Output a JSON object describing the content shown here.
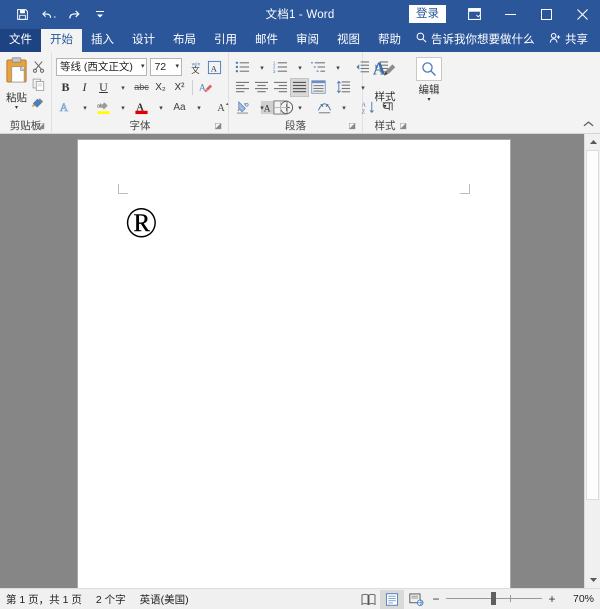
{
  "titlebar": {
    "document_title": "文档1  -  Word",
    "quick_access": [
      {
        "name": "save",
        "label": "保存"
      },
      {
        "name": "undo",
        "label": "撤消"
      },
      {
        "name": "redo",
        "label": "恢复"
      },
      {
        "name": "customize-qat",
        "label": "自定义快速访问工具栏"
      }
    ],
    "signin_label": "登录",
    "ribbon_display_label": "功能区显示选项",
    "minimize_label": "最小化",
    "maximize_label": "最大化",
    "close_label": "关闭"
  },
  "tabs": [
    {
      "label": "文件",
      "active": false,
      "file": true
    },
    {
      "label": "开始",
      "active": true
    },
    {
      "label": "插入",
      "active": false
    },
    {
      "label": "设计",
      "active": false
    },
    {
      "label": "布局",
      "active": false
    },
    {
      "label": "引用",
      "active": false
    },
    {
      "label": "邮件",
      "active": false
    },
    {
      "label": "审阅",
      "active": false
    },
    {
      "label": "视图",
      "active": false
    },
    {
      "label": "帮助",
      "active": false
    }
  ],
  "tellme": {
    "placeholder": "告诉我你想要做什么"
  },
  "share": {
    "label": "共享"
  },
  "ribbon": {
    "collapse_label": "折叠功能区",
    "groups": {
      "clipboard": {
        "label": "剪贴板",
        "paste_label": "粘贴",
        "cut_label": "剪切",
        "copy_label": "复制",
        "format_painter_label": "格式刷"
      },
      "font": {
        "label": "字体",
        "font_name": "等线 (西文正文)",
        "font_size": "72",
        "bold_label": "B",
        "italic_label": "I",
        "underline_label": "U",
        "strikethrough_label": "abc",
        "subscript_label": "X₂",
        "superscript_label": "X²",
        "text_effects_label": "A",
        "highlight_label": "ab",
        "font_color_label": "A",
        "change_case_label": "Aa",
        "grow_font_label": "A",
        "shrink_font_label": "A",
        "char_shading_label": "A",
        "char_border_label": "A",
        "phonetic_guide_label": "文",
        "enclose_char_label": "A",
        "clear_format_label": "清除所有格式",
        "highlight_color": "#ffff00",
        "font_color": "#e00000"
      },
      "paragraph": {
        "label": "段落",
        "bullets_label": "项目符号",
        "numbering_label": "编号",
        "multilevel_label": "多级列表",
        "decrease_indent_label": "减少缩进量",
        "increase_indent_label": "增加缩进量",
        "align_left_label": "左对齐",
        "align_center_label": "居中",
        "align_right_label": "右对齐",
        "justify_label": "两端对齐",
        "distribute_label": "分散对齐",
        "line_spacing_label": "行和段落间距",
        "shading_label": "底纹",
        "borders_label": "边框",
        "cn_layout_label": "中文版式",
        "sort_label": "排序",
        "show_marks_label": "显示编辑标记"
      },
      "styles": {
        "label": "样式",
        "styles_button_label": "样式",
        "editing_button_label": "编辑"
      }
    }
  },
  "document": {
    "content": "®"
  },
  "statusbar": {
    "page_info": "第 1 页，共 1 页",
    "word_count": "2 个字",
    "language": "英语(美国)",
    "view_read_label": "阅读视图",
    "view_print_label": "页面视图",
    "view_web_label": "Web 版式视图",
    "zoom_out_label": "−",
    "zoom_in_label": "+",
    "zoom_level": "70%"
  }
}
